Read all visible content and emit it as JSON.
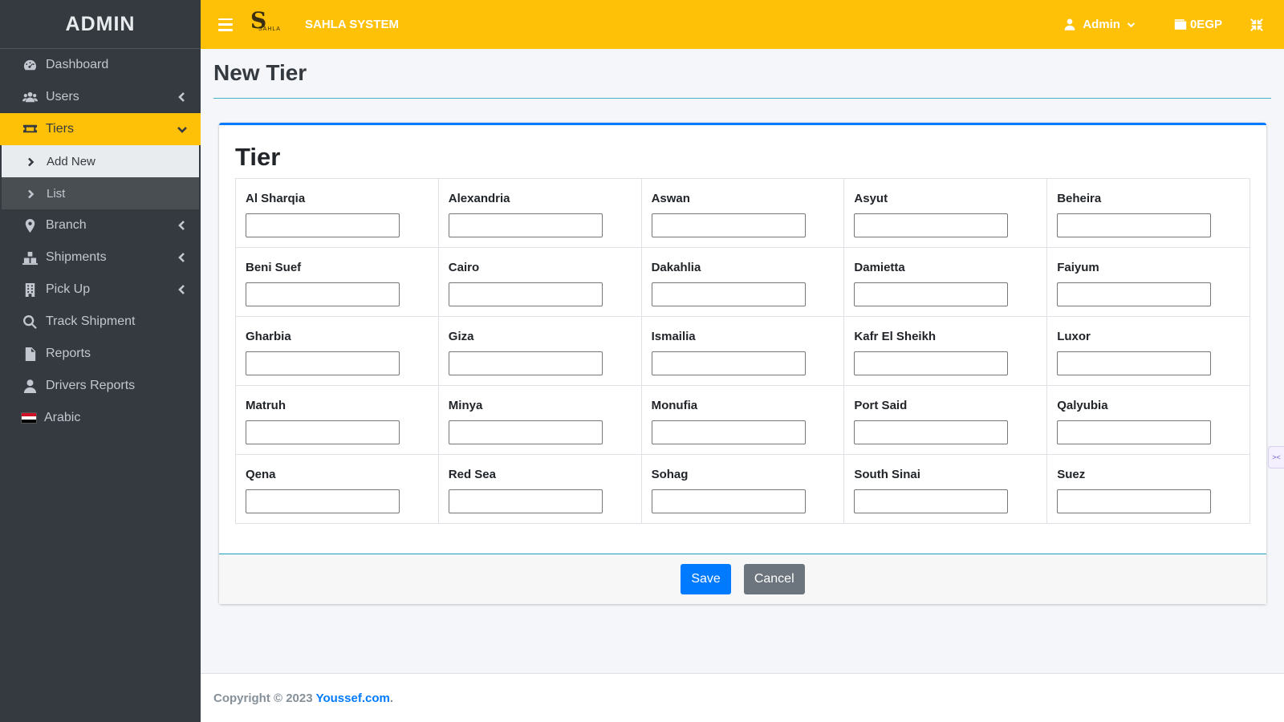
{
  "sidebar": {
    "brand": "ADMIN",
    "items": [
      {
        "label": "Dashboard",
        "icon": "dashboard-icon"
      },
      {
        "label": "Users",
        "icon": "users-icon"
      },
      {
        "label": "Tiers",
        "icon": "tiers-icon"
      },
      {
        "label": "Branch",
        "icon": "map-marker-icon"
      },
      {
        "label": "Shipments",
        "icon": "shipments-icon"
      },
      {
        "label": "Pick Up",
        "icon": "building-icon"
      },
      {
        "label": "Track Shipment",
        "icon": "search-icon"
      },
      {
        "label": "Reports",
        "icon": "file-icon"
      },
      {
        "label": "Drivers Reports",
        "icon": "user-icon"
      },
      {
        "label": "Arabic",
        "icon": "egypt-flag-icon"
      }
    ],
    "tiers_sub": [
      {
        "label": "Add New"
      },
      {
        "label": "List"
      }
    ]
  },
  "topbar": {
    "logo_letter": "S",
    "logo_text": "SAHLA",
    "system_name": "SAHLA SYSTEM",
    "user": "Admin",
    "balance": "0EGP"
  },
  "page": {
    "title": "New Tier",
    "card_title": "Tier"
  },
  "form": {
    "rows": [
      [
        "Al Sharqia",
        "Alexandria",
        "Aswan",
        "Asyut",
        "Beheira"
      ],
      [
        "Beni Suef",
        "Cairo",
        "Dakahlia",
        "Damietta",
        "Faiyum"
      ],
      [
        "Gharbia",
        "Giza",
        "Ismailia",
        "Kafr El Sheikh",
        "Luxor"
      ],
      [
        "Matruh",
        "Minya",
        "Monufia",
        "Port Said",
        "Qalyubia"
      ],
      [
        "Qena",
        "Red Sea",
        "Sohag",
        "South Sinai",
        "Suez"
      ]
    ],
    "save_label": "Save",
    "cancel_label": "Cancel"
  },
  "footer": {
    "copyright": "Copyright © 2023",
    "link": "Youssef.com",
    "period": "."
  },
  "colors": {
    "accent": "#ffc107",
    "sidebar": "#343a40",
    "primary": "#007bff",
    "secondary": "#6c757d"
  }
}
